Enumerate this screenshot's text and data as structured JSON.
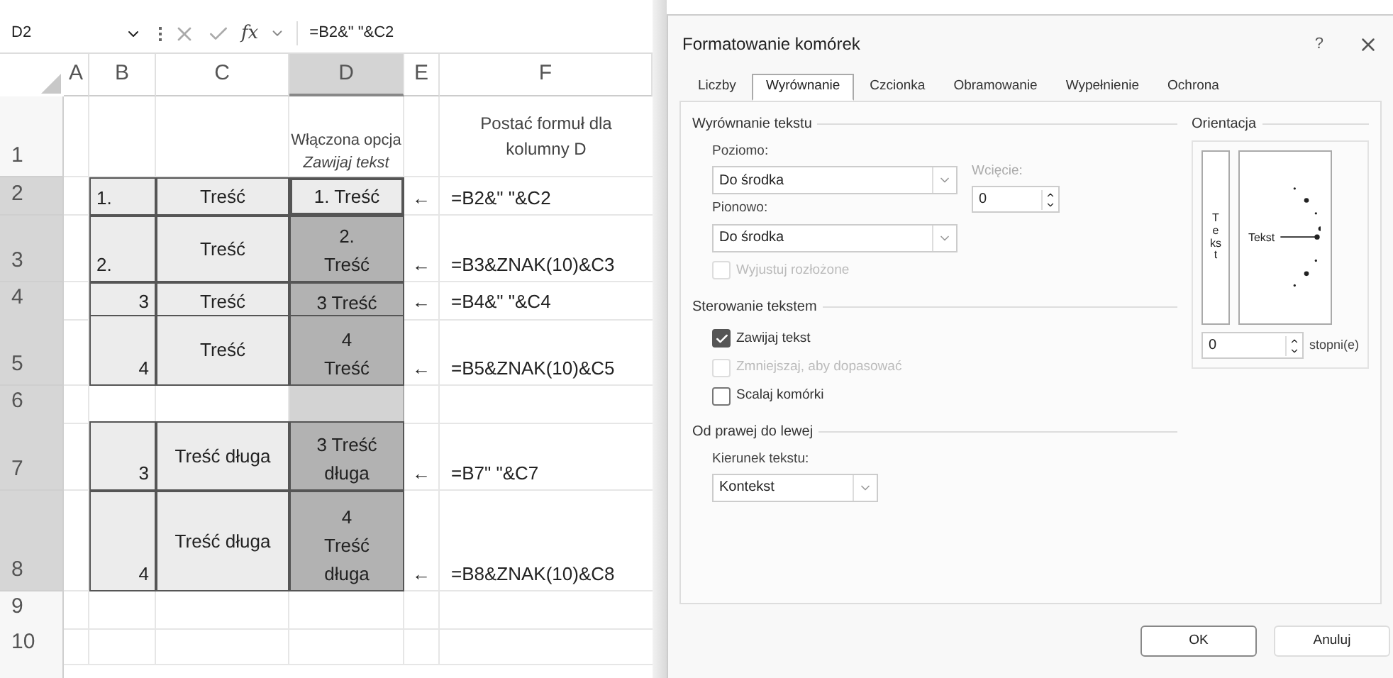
{
  "formula_bar": {
    "name_box": "D2",
    "fx": "fx",
    "formula": "=B2&\" \"&C2"
  },
  "columns": [
    {
      "label": "A",
      "selected": false
    },
    {
      "label": "B",
      "selected": false
    },
    {
      "label": "C",
      "selected": false
    },
    {
      "label": "D",
      "selected": true
    },
    {
      "label": "E",
      "selected": false
    },
    {
      "label": "F",
      "selected": false
    }
  ],
  "rows": [
    {
      "header": "1",
      "selected": false,
      "bordered": false,
      "d": "Włączona opcja *Zawijaj tekst*",
      "d_selected": false,
      "f": "Postać formuł dla kolumny D"
    },
    {
      "header": "2",
      "selected": true,
      "bordered": true,
      "b": {
        "text": "1.",
        "kind": "text"
      },
      "c": "Treść",
      "d": "1. Treść",
      "d_selected": true,
      "d_active": true,
      "e": "←",
      "f": "=B2&\" \"&C2"
    },
    {
      "header": "3",
      "selected": true,
      "bordered": true,
      "b": {
        "text": "2.",
        "kind": "text"
      },
      "c": "Treść",
      "d": "2.\nTreść",
      "d_selected": true,
      "e": "←",
      "f": "=B3&ZNAK(10)&C3"
    },
    {
      "header": "4",
      "selected": true,
      "bordered": true,
      "b": {
        "text": "3",
        "kind": "number"
      },
      "c": "Treść",
      "d": "3 Treść",
      "d_selected": true,
      "e": "←",
      "f": "=B4&\" \"&C4"
    },
    {
      "header": "5",
      "selected": true,
      "bordered": true,
      "b": {
        "text": "4",
        "kind": "number"
      },
      "c": "Treść",
      "d": "4\nTreść",
      "d_selected": true,
      "e": "←",
      "f": "=B5&ZNAK(10)&C5"
    },
    {
      "header": "6",
      "selected": true,
      "bordered": false,
      "d_selected": true
    },
    {
      "header": "7",
      "selected": true,
      "bordered": true,
      "b": {
        "text": "3",
        "kind": "number"
      },
      "c": "Treść długa",
      "d": "3 Treść\ndługa",
      "d_selected": true,
      "e": "←",
      "f": "=B7\" \"&C7"
    },
    {
      "header": "8",
      "selected": true,
      "bordered": true,
      "b": {
        "text": "4",
        "kind": "number"
      },
      "c": "Treść długa",
      "d": "4\nTreść\ndługa",
      "d_selected": true,
      "e": "←",
      "f": "=B8&ZNAK(10)&C8"
    },
    {
      "header": "9",
      "selected": false,
      "bordered": false,
      "d_selected": false
    },
    {
      "header": "10",
      "selected": false,
      "bordered": false,
      "d_selected": false
    }
  ],
  "dialog": {
    "title": "Formatowanie komórek",
    "help": "?",
    "tabs": [
      {
        "label": "Liczby",
        "selected": false
      },
      {
        "label": "Wyrównanie",
        "selected": true
      },
      {
        "label": "Czcionka",
        "selected": false
      },
      {
        "label": "Obramowanie",
        "selected": false
      },
      {
        "label": "Wypełnienie",
        "selected": false
      },
      {
        "label": "Ochrona",
        "selected": false
      }
    ],
    "text_alignment": {
      "title": "Wyrównanie tekstu",
      "horizontal_label": "Poziomo:",
      "horizontal_value": "Do środka",
      "indent_label": "Wcięcie:",
      "indent_disabled": true,
      "indent_value": "0",
      "vertical_label": "Pionowo:",
      "vertical_value": "Do środka",
      "justify": {
        "label": "Wyjustuj rozłożone",
        "checked": false,
        "disabled": true
      }
    },
    "text_control": {
      "title": "Sterowanie tekstem",
      "options": [
        {
          "label": "Zawijaj tekst",
          "checked": true,
          "disabled": false
        },
        {
          "label": "Zmniejszaj, aby dopasować",
          "checked": false,
          "disabled": true
        },
        {
          "label": "Scalaj komórki",
          "checked": false,
          "disabled": false
        }
      ]
    },
    "rtl": {
      "title": "Od prawej do lewej",
      "direction_label": "Kierunek tekstu:",
      "direction_value": "Kontekst"
    },
    "orientation": {
      "title": "Orientacja",
      "vertical_text": "Tekst",
      "dial_text": "Tekst",
      "degrees_value": "0",
      "degrees_label": "stopni(e)"
    },
    "buttons": [
      "OK",
      "Anuluj"
    ]
  }
}
